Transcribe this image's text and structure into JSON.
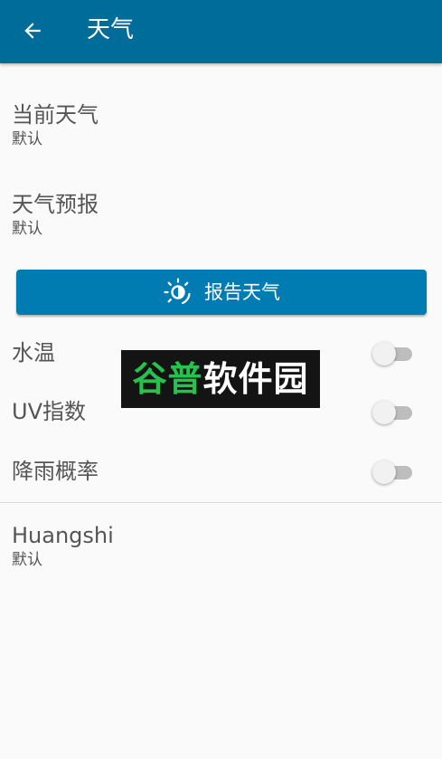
{
  "appbar": {
    "title": "天气",
    "background_color": "#006c9a"
  },
  "preferences": [
    {
      "title": "当前天气",
      "summary": "默认"
    },
    {
      "title": "天气预报",
      "summary": "默认"
    }
  ],
  "report_button": {
    "label": "报告天气",
    "icon": "weather-sun-icon",
    "color": "#007cb3"
  },
  "switches": [
    {
      "label": "水温",
      "checked": false
    },
    {
      "label": "UV指数",
      "checked": false
    },
    {
      "label": "降雨概率",
      "checked": false
    }
  ],
  "location_pref": {
    "title": "Huangshi",
    "summary": "默认"
  },
  "watermark": {
    "part1": "谷普",
    "part2": "软件园"
  }
}
